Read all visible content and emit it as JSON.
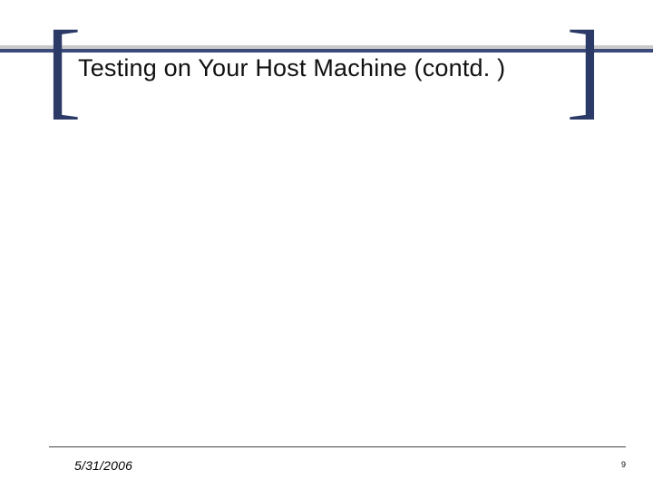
{
  "title": "Testing on Your Host Machine (contd. )",
  "footer": {
    "date": "5/31/2006",
    "page": "9"
  },
  "brackets": {
    "left": "[",
    "right": "]"
  }
}
